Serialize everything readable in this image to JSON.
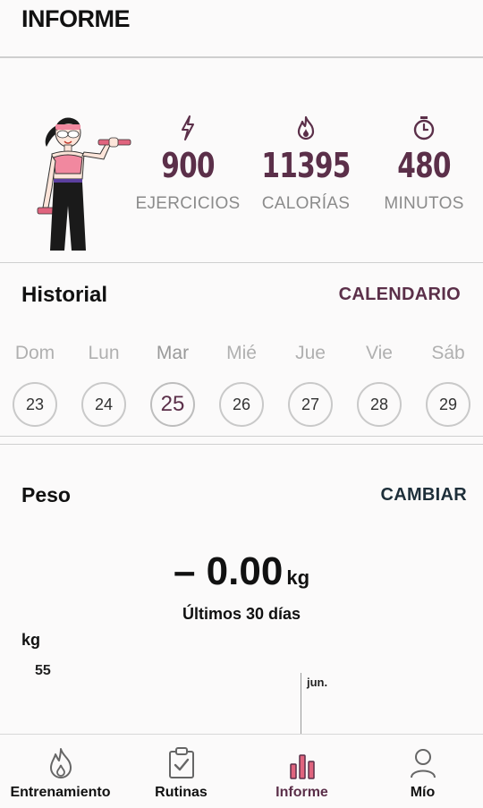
{
  "header": {
    "title": "INFORME"
  },
  "stats": [
    {
      "value": "900",
      "label": "EJERCICIOS",
      "icon": "lightning-icon"
    },
    {
      "value": "11395",
      "label": "CALORÍAS",
      "icon": "flame-icon"
    },
    {
      "value": "480",
      "label": "MINUTOS",
      "icon": "stopwatch-icon"
    }
  ],
  "history": {
    "title": "Historial",
    "calendar_link": "CALENDARIO",
    "days": [
      {
        "name": "Dom",
        "date": "23"
      },
      {
        "name": "Lun",
        "date": "24"
      },
      {
        "name": "Mar",
        "date": "25"
      },
      {
        "name": "Mié",
        "date": "26"
      },
      {
        "name": "Jue",
        "date": "27"
      },
      {
        "name": "Vie",
        "date": "28"
      },
      {
        "name": "Sáb",
        "date": "29"
      }
    ],
    "today_index": 2
  },
  "weight": {
    "title": "Peso",
    "change_link": "CAMBIAR",
    "value": "– 0.00",
    "unit": "kg",
    "range_label": "Últimos 30 días",
    "axis_unit": "kg",
    "axis_tick": "55",
    "month_label": "jun."
  },
  "nav": [
    {
      "label": "Entrenamiento",
      "icon": "flame-icon"
    },
    {
      "label": "Rutinas",
      "icon": "clipboard-check-icon"
    },
    {
      "label": "Informe",
      "icon": "bar-chart-icon",
      "active": true
    },
    {
      "label": "Mío",
      "icon": "person-icon"
    }
  ],
  "colors": {
    "accent": "#5b2f49",
    "pink": "#f1889f",
    "nav_active": "#e0647e"
  }
}
